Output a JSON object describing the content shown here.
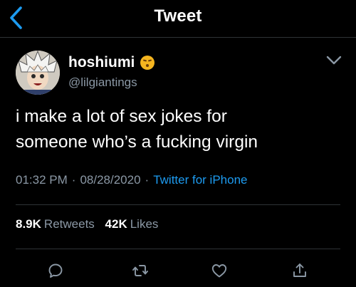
{
  "header": {
    "title": "Tweet",
    "back_icon": "chevron-left-icon",
    "accent": "#1d9bf0"
  },
  "author": {
    "name": "hoshiumi",
    "emoji": "kissing-face-emoji",
    "handle": "@lilgiantings"
  },
  "tweet": {
    "line1": "i make a lot of sex jokes for",
    "line2": "someone who’s a fucking virgin"
  },
  "meta": {
    "time": "01:32 PM",
    "dot1": "·",
    "date": "08/28/2020",
    "dot2": "·",
    "source": "Twitter for iPhone"
  },
  "stats": {
    "retweets_count": "8.9K",
    "retweets_label": "Retweets",
    "likes_count": "42K",
    "likes_label": "Likes"
  },
  "actions": [
    "reply-icon",
    "retweet-icon",
    "like-icon",
    "share-icon"
  ]
}
